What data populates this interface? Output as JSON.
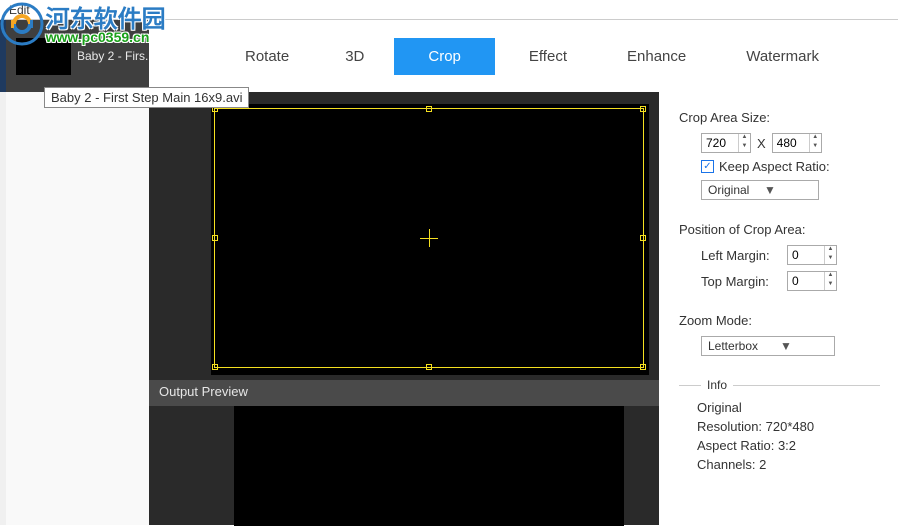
{
  "menu": {
    "edit": "Edit"
  },
  "overlay": {
    "cn": "河东软件园",
    "url_prefix": "www.",
    "url": "pc0359.cn"
  },
  "sidebar": {
    "thumb_label": "Baby 2 - Firs...",
    "tooltip": "Baby 2 - First Step Main 16x9.avi"
  },
  "tabs": {
    "rotate": "Rotate",
    "td": "3D",
    "crop": "Crop",
    "effect": "Effect",
    "enhance": "Enhance",
    "watermark": "Watermark"
  },
  "preview": {
    "output_label": "Output Preview"
  },
  "settings": {
    "crop_size_title": "Crop Area Size:",
    "width": "720",
    "height": "480",
    "x_sep": "X",
    "keep_aspect": "Keep Aspect Ratio:",
    "aspect_mode": "Original",
    "position_title": "Position of Crop Area:",
    "left_margin_label": "Left Margin:",
    "left_margin": "0",
    "top_margin_label": "Top Margin:",
    "top_margin": "0",
    "zoom_title": "Zoom Mode:",
    "zoom_mode": "Letterbox",
    "info_label": "Info",
    "info_original": "Original",
    "info_resolution_label": "Resolution:",
    "info_resolution": "720*480",
    "info_aspect_label": "Aspect Ratio:",
    "info_aspect": "3:2",
    "info_channels_label": "Channels:",
    "info_channels": "2"
  }
}
